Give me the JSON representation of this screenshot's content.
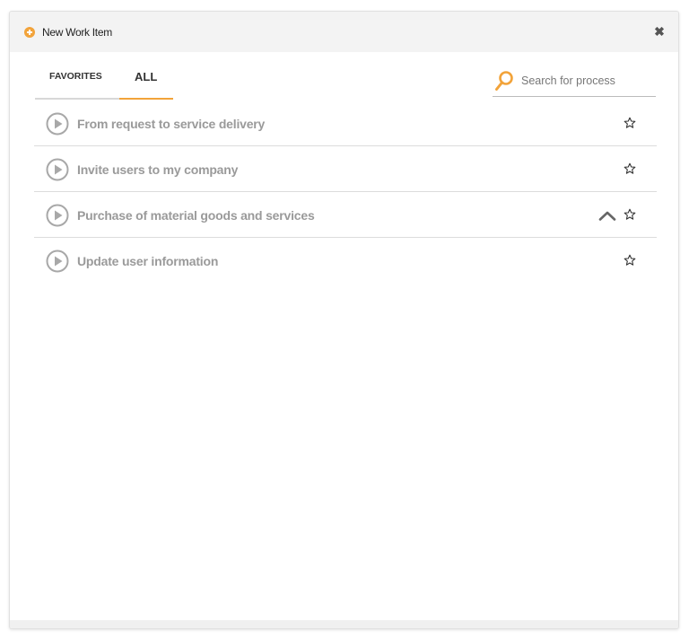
{
  "dialog": {
    "title": "New Work Item",
    "header_icon": "plus-circle-icon",
    "close_icon": "close-icon",
    "accent_color": "#f2a33a"
  },
  "tabs": [
    {
      "label": "FAVORITES",
      "active": false
    },
    {
      "label": "ALL",
      "active": true
    }
  ],
  "search": {
    "placeholder": "Search for process",
    "value": "",
    "icon": "search-icon"
  },
  "processes": [
    {
      "label": "From request to service delivery",
      "favorite": false
    },
    {
      "label": "Invite users to my company",
      "favorite": false
    },
    {
      "label": "Purchase of material goods and services",
      "favorite": false,
      "hover_icon": "chevron-up-icon"
    },
    {
      "label": "Update user information",
      "favorite": false
    }
  ]
}
